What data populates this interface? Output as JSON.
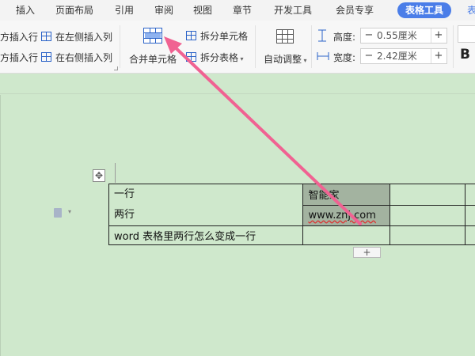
{
  "menu": {
    "tabs": [
      "插入",
      "页面布局",
      "引用",
      "审阅",
      "视图",
      "章节",
      "开发工具",
      "会员专享"
    ],
    "active_tab": "表格工具",
    "cut_tab": "表"
  },
  "ribbon": {
    "insert_row_above": "方插入行",
    "insert_row_below": "方插入行",
    "insert_col_left": "在左侧插入列",
    "insert_col_right": "在右侧插入列",
    "merge_cells": "合并单元格",
    "split_cells": "拆分单元格",
    "split_table": "拆分表格",
    "auto_fit": "自动调整",
    "height_label": "高度:",
    "height_value": "0.55厘米",
    "width_label": "宽度:",
    "width_value": "2.42厘米",
    "minus": "−",
    "plus": "+",
    "bold": "B"
  },
  "document": {
    "table": {
      "cell_a1_line1": "一行",
      "cell_a1_line2": "两行",
      "cell_b1": "智能家",
      "cell_b2": "www.znj.com",
      "cell_a3": "word 表格里两行怎么变成一行"
    },
    "add_row_symbol": "+",
    "move_handle_symbol": "✥"
  },
  "annotation": {
    "arrow_color": "#f06292"
  }
}
